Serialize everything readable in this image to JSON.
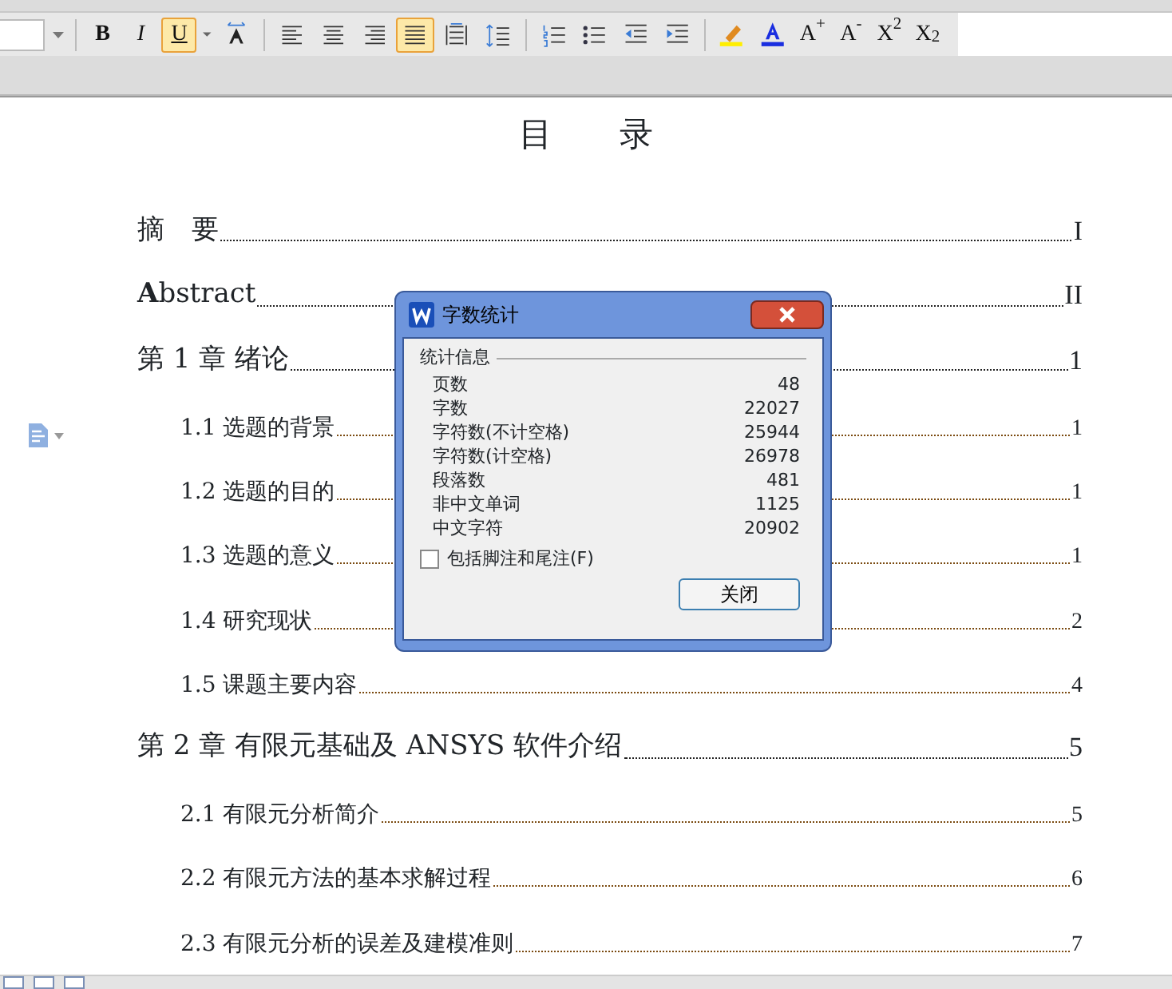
{
  "toolbar": {
    "buttons": [
      {
        "kind": "text",
        "label": "B",
        "selected": false
      },
      {
        "kind": "text",
        "label": "I",
        "selected": false
      },
      {
        "kind": "text",
        "label": "U",
        "selected": true
      },
      {
        "kind": "caret",
        "selected": false
      },
      {
        "kind": "char-spacing",
        "selected": false
      },
      {
        "kind": "align-left",
        "selected": false
      },
      {
        "kind": "align-center",
        "selected": false
      },
      {
        "kind": "align-right",
        "selected": false
      },
      {
        "kind": "justify",
        "selected": true
      },
      {
        "kind": "distribute",
        "selected": false
      },
      {
        "kind": "line-spacing",
        "selected": false
      },
      {
        "kind": "numbering",
        "selected": false
      },
      {
        "kind": "bullets",
        "selected": false
      },
      {
        "kind": "outdent",
        "selected": false
      },
      {
        "kind": "indent",
        "selected": false
      },
      {
        "kind": "highlight",
        "selected": false
      },
      {
        "kind": "font-color",
        "selected": false
      },
      {
        "kind": "text",
        "label": "A$^{+}$",
        "selected": false
      },
      {
        "kind": "text",
        "label": "A$^{-}$",
        "selected": false
      },
      {
        "kind": "text",
        "label": "X$^{2}$",
        "selected": false
      },
      {
        "kind": "text",
        "label": "X$_{2}$",
        "selected": false
      }
    ]
  },
  "document": {
    "title": "目　　录",
    "toc": [
      {
        "title": "摘　要",
        "page": "I"
      },
      {
        "title": "**A**bstract",
        "page": "II"
      },
      {
        "title": "第 1 章  绪论",
        "page": "1",
        "children": [
          {
            "title": "1.1  选题的背景",
            "page": "1"
          },
          {
            "title": "1.2  选题的目的",
            "page": "1"
          },
          {
            "title": "1.3  选题的意义",
            "page": "1"
          },
          {
            "title": "1.4  研究现状",
            "page": "2"
          },
          {
            "title": "1.5  课题主要内容",
            "page": "4"
          }
        ]
      },
      {
        "title": "第 2 章  有限元基础及 ANSYS 软件介绍",
        "page": "5",
        "children": [
          {
            "title": "2.1  有限元分析简介",
            "page": "5"
          },
          {
            "title": "2.2  有限元方法的基本求解过程",
            "page": "6"
          },
          {
            "title": "2.3  有限元分析的误差及建模准则",
            "page": "7"
          }
        ]
      }
    ]
  },
  "dialog": {
    "title": "字数统计",
    "group": "统计信息",
    "stats": [
      {
        "label": "页数",
        "value": "48"
      },
      {
        "label": "字数",
        "value": "22027"
      },
      {
        "label": "字符数(不计空格)",
        "value": "25944"
      },
      {
        "label": "字符数(计空格)",
        "value": "26978"
      },
      {
        "label": "段落数",
        "value": "481"
      },
      {
        "label": "非中文单词",
        "value": "1125"
      },
      {
        "label": "中文字符",
        "value": "20902"
      }
    ],
    "checkbox": {
      "label": "包括脚注和尾注(F)",
      "checked": false
    },
    "button": "关闭"
  }
}
